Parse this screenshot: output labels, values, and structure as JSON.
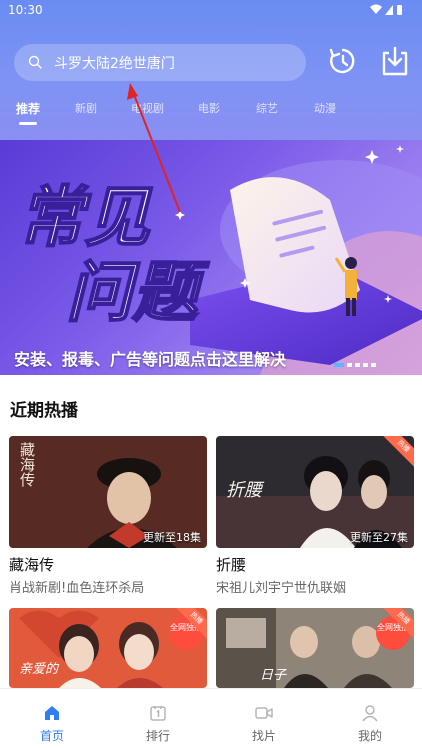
{
  "status_bar": {
    "time": "10:30"
  },
  "search": {
    "placeholder": "斗罗大陆2绝世唐门"
  },
  "header_icons": {
    "history": "history-icon",
    "download": "download-icon"
  },
  "tabs": [
    {
      "label": "推荐",
      "active": true
    },
    {
      "label": "新剧",
      "active": false
    },
    {
      "label": "电视剧",
      "active": false
    },
    {
      "label": "电影",
      "active": false
    },
    {
      "label": "综艺",
      "active": false
    },
    {
      "label": "动漫",
      "active": false
    }
  ],
  "banner": {
    "headline_line1": "常见",
    "headline_line2": "问题",
    "caption": "安装、报毒、广告等问题点击这里解决",
    "slide_count": 5,
    "active_slide": 1
  },
  "recent": {
    "title": "近期热播",
    "items": [
      {
        "title": "藏海传",
        "subtitle": "肖战新剧!血色连环杀局",
        "episode": "更新至18集",
        "poster_text": "藏海传"
      },
      {
        "title": "折腰",
        "subtitle": "宋祖儿刘宇宁世仇联姻",
        "episode": "更新至27集",
        "poster_text": "折腰",
        "tag": "热播"
      },
      {
        "title": "",
        "subtitle": "",
        "episode": "",
        "poster_text": "亲爱的",
        "tag": "热播",
        "badge": "全网独播"
      },
      {
        "title": "",
        "subtitle": "",
        "episode": "",
        "poster_text": "日子",
        "tag": "热播",
        "badge": "全网独播"
      }
    ]
  },
  "bottom_nav": [
    {
      "label": "首页",
      "icon": "home-icon",
      "active": true
    },
    {
      "label": "排行",
      "icon": "ranking-icon",
      "active": false
    },
    {
      "label": "找片",
      "icon": "video-icon",
      "active": false
    },
    {
      "label": "我的",
      "icon": "profile-icon",
      "active": false
    }
  ],
  "colors": {
    "accent": "#2f7cf6",
    "header": "#6a8cf2",
    "banner": "#7a5ae8",
    "hot_tag": "#ff6a4d"
  }
}
